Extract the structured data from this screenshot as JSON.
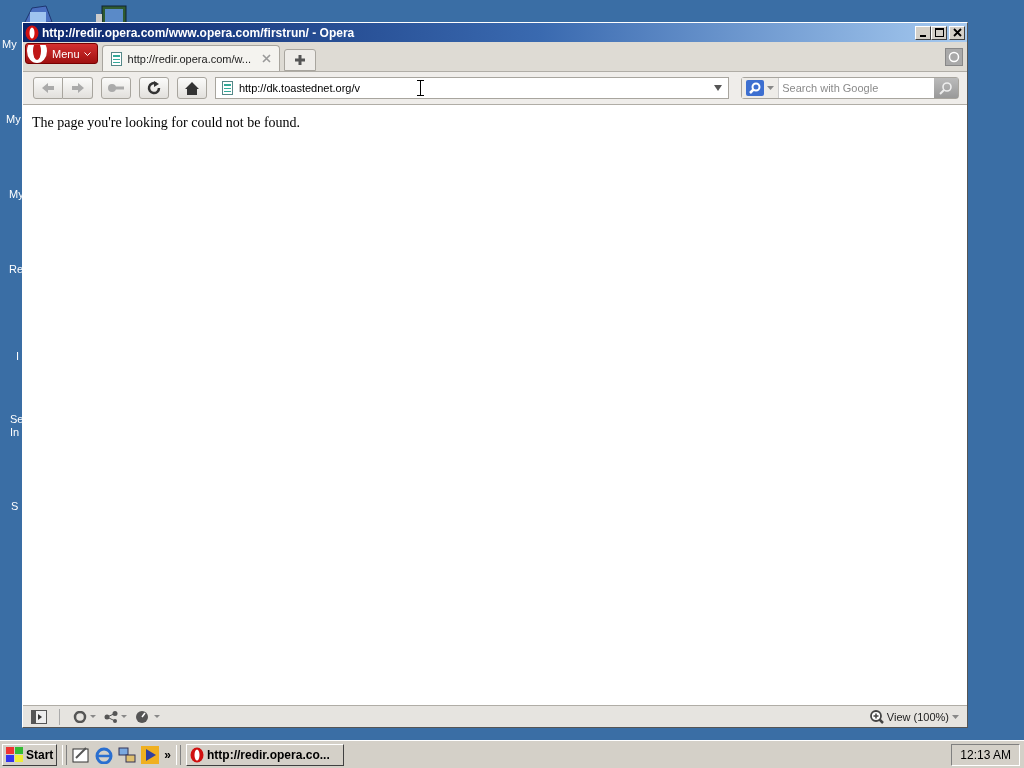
{
  "desktop": {
    "icon_labels": [
      "My",
      "My",
      "My",
      "Re",
      "I",
      "Se\nIn",
      "S"
    ]
  },
  "window": {
    "title": "http://redir.opera.com/www.opera.com/firstrun/ - Opera",
    "menu_label": "Menu",
    "tabs": [
      {
        "label": "http://redir.opera.com/w...",
        "selected": true
      }
    ],
    "address": {
      "value": "http://dk.toastednet.org/v"
    },
    "search": {
      "placeholder": "Search with Google"
    },
    "page": {
      "message": "The page you're looking for could not be found."
    },
    "status_bar": {
      "zoom": "View (100%)"
    }
  },
  "taskbar": {
    "start": "Start",
    "more": "»",
    "tasks": [
      {
        "label": "http://redir.opera.co...",
        "selected": false
      }
    ],
    "clock": "12:13 AM"
  }
}
